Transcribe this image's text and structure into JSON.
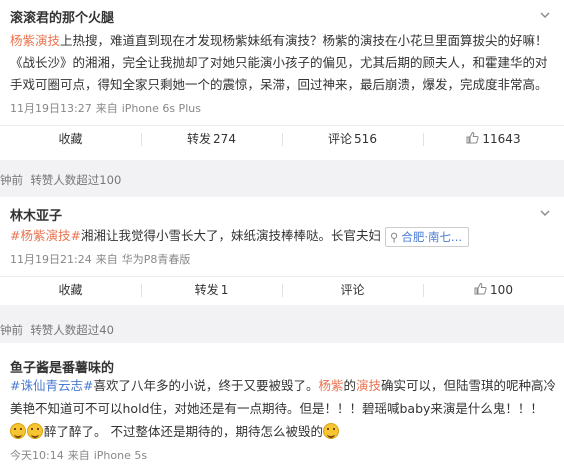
{
  "posts": [
    {
      "author": "滚滚君的那个火腿",
      "lines": [
        {
          "tag": "杨紫演技",
          "text": "上热搜，难道直到现在才发现杨紫妹纸有演技？杨紫的演技在小花旦里面算拔尖的好嘛！"
        },
        {
          "text": "《战长沙》的湘湘，完全让我抛却了对她只能演小孩子的偏见，尤其后期的顾夫人，和霍建华的对"
        },
        {
          "text": "手戏可圈可点，得知全家只剩她一个的震惊，呆滞，回过神来，最后崩溃，爆发，完成度非常高。"
        }
      ],
      "meta": {
        "time": "11月19日13:27",
        "from": "来自",
        "device": "iPhone 6s Plus"
      },
      "actions": {
        "collect": "收藏",
        "repost": "转发",
        "repost_count": "274",
        "comment": "评论",
        "comment_count": "516",
        "like_count": "11643"
      }
    },
    {
      "author": "林木亚子",
      "lines": [
        {
          "tag": "#杨紫演技#",
          "text": "湘湘让我觉得小雪长大了，妹纸演技棒棒哒。长官夫妇"
        }
      ],
      "location": "合肥·南七...",
      "meta": {
        "time": "11月19日21:24",
        "from": "来自",
        "device": "华为P8青春版"
      },
      "actions": {
        "collect": "收藏",
        "repost": "转发",
        "repost_count": "1",
        "comment": "评论",
        "comment_count": "",
        "like_count": "100"
      }
    },
    {
      "author": "鱼子酱是番薯味的",
      "line1_tag": "#诛仙青云志#",
      "line1_a": "喜欢了八年多的小说，终于又要被毁了。",
      "line1_b": "杨紫",
      "line1_c": "的",
      "line1_d": "演技",
      "line1_e": "确实可以，但陆雪琪的呢种高冷",
      "line2": "美艳不知道可不可以hold住，对她还是有一点期待。但是！！！碧瑶喊baby来演是什么鬼！！！",
      "line3_a": "醉了醉了。",
      "line3_b": "不过整体还是期待的，期待怎么被毁的",
      "meta": {
        "time": "今天10:14",
        "from": "来自",
        "device": "iPhone 5s"
      }
    }
  ],
  "gaps": [
    {
      "time": "钟前",
      "label": "转赞人数超过100"
    },
    {
      "time": "钟前",
      "label": "转赞人数超过40"
    }
  ],
  "icons": {
    "chevron": "chevron-down-icon",
    "like": "thumb-up-icon",
    "location": "location-pin-icon",
    "emoji": "laugh-emoji-icon"
  },
  "colors": {
    "topic": "#eb7350",
    "link": "#4a7bd1"
  }
}
